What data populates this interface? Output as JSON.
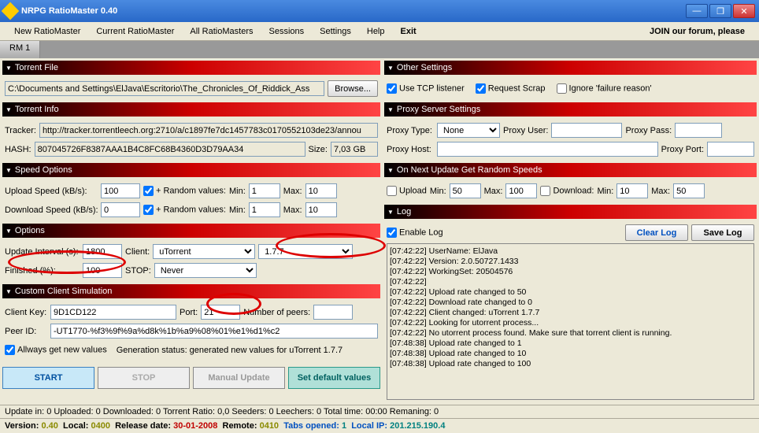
{
  "window": {
    "title": "NRPG RatioMaster 0.40"
  },
  "menu": {
    "new": "New RatioMaster",
    "current": "Current RatioMaster",
    "all": "All RatioMasters",
    "sessions": "Sessions",
    "settings": "Settings",
    "help": "Help",
    "exit": "Exit",
    "forum": "JOIN our forum, please"
  },
  "tab": "RM 1",
  "torrentFile": {
    "hdr": "Torrent File",
    "path": "C:\\Documents and Settings\\ElJava\\Escritorio\\The_Chronicles_Of_Riddick_Ass",
    "browse": "Browse..."
  },
  "torrentInfo": {
    "hdr": "Torrent Info",
    "trackerLbl": "Tracker:",
    "tracker": "http://tracker.torrentleech.org:2710/a/c1897fe7dc1457783c0170552103de23/annou",
    "hashLbl": "HASH:",
    "hash": "807045726F8387AAA1B4C8FC68B4360D3D79AA34",
    "sizeLbl": "Size:",
    "size": "7,03 GB"
  },
  "speed": {
    "hdr": "Speed Options",
    "upLbl": "Upload Speed (kB/s):",
    "up": "100",
    "dnLbl": "Download Speed (kB/s):",
    "dn": "0",
    "rand": "+ Random values:",
    "minLbl": "Min:",
    "min": "1",
    "maxLbl": "Max:",
    "max": "10"
  },
  "options": {
    "hdr": "Options",
    "intervalLbl": "Update Interval (s):",
    "interval": "1800",
    "clientLbl": "Client:",
    "client": "uTorrent",
    "ver": "1.7.7",
    "finishedLbl": "Finished (%):",
    "finished": "100",
    "stopLbl": "STOP:",
    "stop": "Never"
  },
  "custom": {
    "hdr": "Custom Client Simulation",
    "keyLbl": "Client Key:",
    "key": "9D1CD122",
    "portLbl": "Port:",
    "port": "21",
    "peersLbl": "Number of peers:",
    "peers": "",
    "peerIdLbl": "Peer ID:",
    "peerId": "-UT1770-%f3%9f%9a%d8k%1b%a9%08%01%e1%d1%c2",
    "always": "Allways get new values",
    "gen": "Generation status: generated new values for uTorrent 1.7.7"
  },
  "buttons": {
    "start": "START",
    "stop": "STOP",
    "manual": "Manual Update",
    "def": "Set default values"
  },
  "other": {
    "hdr": "Other Settings",
    "tcp": "Use TCP listener",
    "scrap": "Request Scrap",
    "ignore": "Ignore 'failure reason'"
  },
  "proxy": {
    "hdr": "Proxy Server Settings",
    "typeLbl": "Proxy Type:",
    "type": "None",
    "userLbl": "Proxy User:",
    "passLbl": "Proxy Pass:",
    "hostLbl": "Proxy Host:",
    "portLbl": "Proxy Port:"
  },
  "rand": {
    "hdr": "On Next Update Get Random Speeds",
    "up": "Upload",
    "minLbl": "Min:",
    "min1": "50",
    "maxLbl": "Max:",
    "max1": "100",
    "dn": "Download:",
    "min2": "10",
    "max2": "50"
  },
  "log": {
    "hdr": "Log",
    "enable": "Enable Log",
    "clear": "Clear Log",
    "save": "Save Log",
    "lines": [
      "[07:42:22] UserName: ElJava",
      "[07:42:22] Version: 2.0.50727.1433",
      "[07:42:22] WorkingSet: 20504576",
      "[07:42:22]",
      "[07:42:22] Upload rate changed to 50",
      "[07:42:22] Download rate changed to 0",
      "[07:42:22] Client changed: uTorrent 1.7.7",
      "[07:42:22] Looking for utorrent process...",
      "[07:42:22] No utorrent process found. Make sure that torrent client is running.",
      "[07:48:38] Upload rate changed to 1",
      "[07:48:38] Upload rate changed to 10",
      "[07:48:38] Upload rate changed to 100"
    ]
  },
  "status": "Update in:  0   Uploaded:  0   Downloaded:  0   Torrent Ratio:  0,0   Seeders: 0   Leechers: 0   Total time:   00:00   Remaning:  0",
  "version": {
    "v": "Version:",
    "vv": "0.40",
    "l": "Local:",
    "lv": "0400",
    "r": "Release date:",
    "rv": "30-01-2008",
    "rm": "Remote:",
    "rmv": "0410",
    "t": "Tabs opened:",
    "tv": "1",
    "ip": "Local IP:",
    "ipv": "201.215.190.4"
  }
}
